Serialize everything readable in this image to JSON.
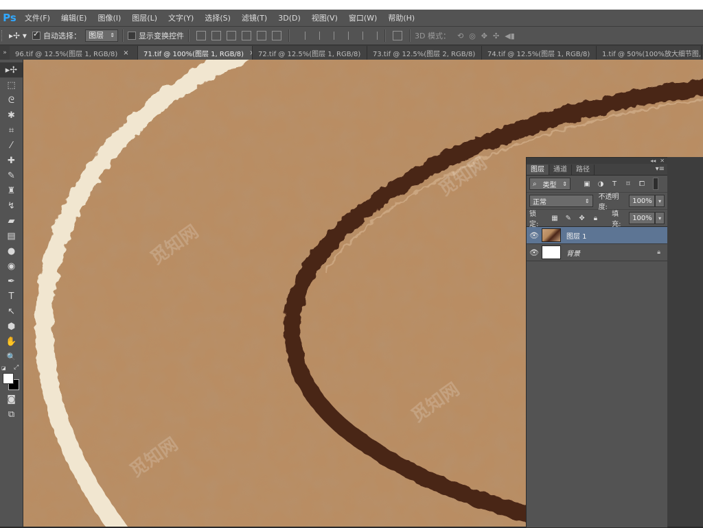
{
  "app": {
    "logo": "Ps"
  },
  "menus": [
    "文件(F)",
    "编辑(E)",
    "图像(I)",
    "图层(L)",
    "文字(Y)",
    "选择(S)",
    "滤镜(T)",
    "3D(D)",
    "视图(V)",
    "窗口(W)",
    "帮助(H)"
  ],
  "options": {
    "auto_select_label": "自动选择：",
    "auto_select_checked": true,
    "auto_select_target": "图层",
    "show_transform_label": "显示变换控件",
    "show_transform_checked": false,
    "mode_3d_label": "3D 模式："
  },
  "tabs": [
    {
      "label": "96.tif @ 12.5%(图层 1, RGB/8)",
      "close": "×",
      "active": false
    },
    {
      "label": "71.tif @ 100%(图层 1, RGB/8)",
      "close": "×",
      "active": true
    },
    {
      "label": "72.tif @ 12.5%(图层 1, RGB/8)",
      "close": "×",
      "active": false
    },
    {
      "label": "73.tif @ 12.5%(图层 2, RGB/8)",
      "close": "×",
      "active": false
    },
    {
      "label": "74.tif @ 12.5%(图层 1, RGB/8)",
      "close": "×",
      "active": false
    },
    {
      "label": "1.tif @ 50%(100%放大细节图,",
      "close": "",
      "active": false
    }
  ],
  "tools": [
    {
      "icon": "move-tool-icon",
      "glyph": "▸✢"
    },
    {
      "icon": "marquee-tool-icon",
      "glyph": "⬚"
    },
    {
      "icon": "lasso-tool-icon",
      "glyph": "ᘓ"
    },
    {
      "icon": "magic-wand-icon",
      "glyph": "✱"
    },
    {
      "icon": "crop-tool-icon",
      "glyph": "⌗"
    },
    {
      "icon": "eyedropper-icon",
      "glyph": "⁄"
    },
    {
      "icon": "healing-brush-icon",
      "glyph": "✚"
    },
    {
      "icon": "brush-tool-icon",
      "glyph": "✎"
    },
    {
      "icon": "clone-stamp-icon",
      "glyph": "♜"
    },
    {
      "icon": "history-brush-icon",
      "glyph": "↯"
    },
    {
      "icon": "eraser-tool-icon",
      "glyph": "▰"
    },
    {
      "icon": "gradient-tool-icon",
      "glyph": "▤"
    },
    {
      "icon": "blur-tool-icon",
      "glyph": "●"
    },
    {
      "icon": "dodge-tool-icon",
      "glyph": "◉"
    },
    {
      "icon": "pen-tool-icon",
      "glyph": "✒"
    },
    {
      "icon": "type-tool-icon",
      "glyph": "T"
    },
    {
      "icon": "path-select-icon",
      "glyph": "↖"
    },
    {
      "icon": "shape-tool-icon",
      "glyph": "⬢"
    },
    {
      "icon": "hand-tool-icon",
      "glyph": "✋"
    },
    {
      "icon": "zoom-tool-icon",
      "glyph": "🔍"
    }
  ],
  "watermark": "觅知网",
  "layers_panel": {
    "tabs": [
      "图层",
      "通道",
      "路径"
    ],
    "active_tab": 0,
    "filter_kind": "类型",
    "blend_mode": "正常",
    "opacity_label": "不透明度:",
    "opacity_value": "100%",
    "lock_label": "锁定:",
    "fill_label": "填充:",
    "fill_value": "100%",
    "layers": [
      {
        "name": "图层 1",
        "selected": true,
        "locked": false
      },
      {
        "name": "背景",
        "selected": false,
        "locked": true
      }
    ]
  },
  "colors": {
    "accent": "#31a8ff",
    "canvas_bg": "#b98d63",
    "selected_layer": "#5d7594"
  }
}
